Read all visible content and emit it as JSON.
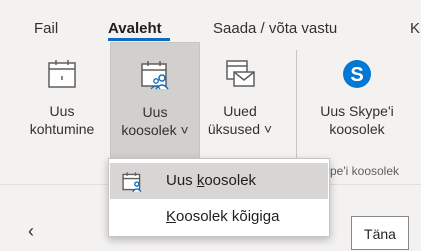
{
  "tabs": [
    {
      "label": "Fail"
    },
    {
      "label": "Avaleht"
    },
    {
      "label": "Saada / võta vastu"
    },
    {
      "label": "K"
    }
  ],
  "ribbon": {
    "new_appointment": {
      "line1": "Uus",
      "line2": "kohtumine",
      "icon": "calendar-icon"
    },
    "new_meeting": {
      "line1": "Uus",
      "line2": "koosolek ˅",
      "icon": "calendar-people-icon"
    },
    "new_items": {
      "line1": "Uued",
      "line2": "üksused ˅",
      "icon": "calendar-mail-icon"
    },
    "skype_meeting": {
      "line1": "Uus Skype'i",
      "line2": "koosolek",
      "icon": "skype-icon"
    },
    "skype_group_label": "pe'i koosolek"
  },
  "menu": {
    "items": [
      {
        "label_pre": "Uus ",
        "label_u": "k",
        "label_post": "oosolek",
        "icon": "calendar-people-icon"
      },
      {
        "label_pre": "",
        "label_u": "K",
        "label_post": "oosolek kõigiga",
        "icon": ""
      }
    ]
  },
  "nav": {
    "prev_icon": "chevron-left-icon",
    "today": "Täna"
  },
  "colors": {
    "accent": "#0f6cbd",
    "skype": "#0078d4",
    "hover": "#d7d6d5"
  }
}
